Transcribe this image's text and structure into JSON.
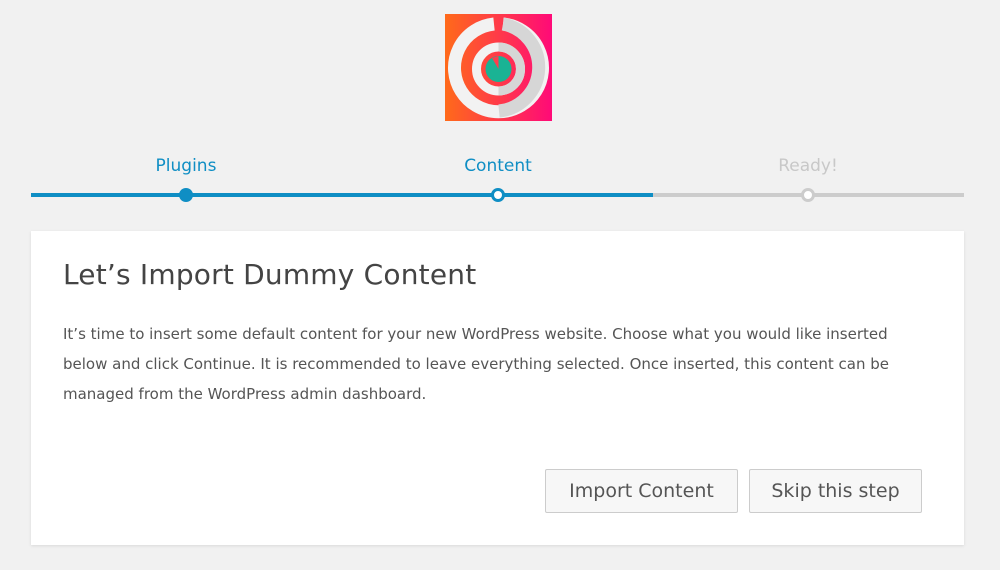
{
  "logo": {
    "icon": "ring-logo-icon",
    "colors": {
      "gradient_start": "#ff6a1a",
      "gradient_end": "#ff0a78",
      "ring": "#f1f1f1",
      "center": "#1ab394"
    }
  },
  "steps": [
    {
      "label": "Plugins",
      "state": "done"
    },
    {
      "label": "Content",
      "state": "current"
    },
    {
      "label": "Ready!",
      "state": "todo"
    }
  ],
  "progress": {
    "fraction": 0.667
  },
  "card": {
    "title": "Let’s Import Dummy Content",
    "description": "It’s time to insert some default content for your new WordPress website. Choose what you would like inserted below and click Continue. It is recommended to leave everything selected. Once inserted, this content can be managed from the WordPress admin dashboard."
  },
  "buttons": {
    "import_label": "Import Content",
    "skip_label": "Skip this step"
  },
  "colors": {
    "accent": "#0f8ec4",
    "inactive": "#cccccc",
    "background": "#f1f1f1"
  }
}
